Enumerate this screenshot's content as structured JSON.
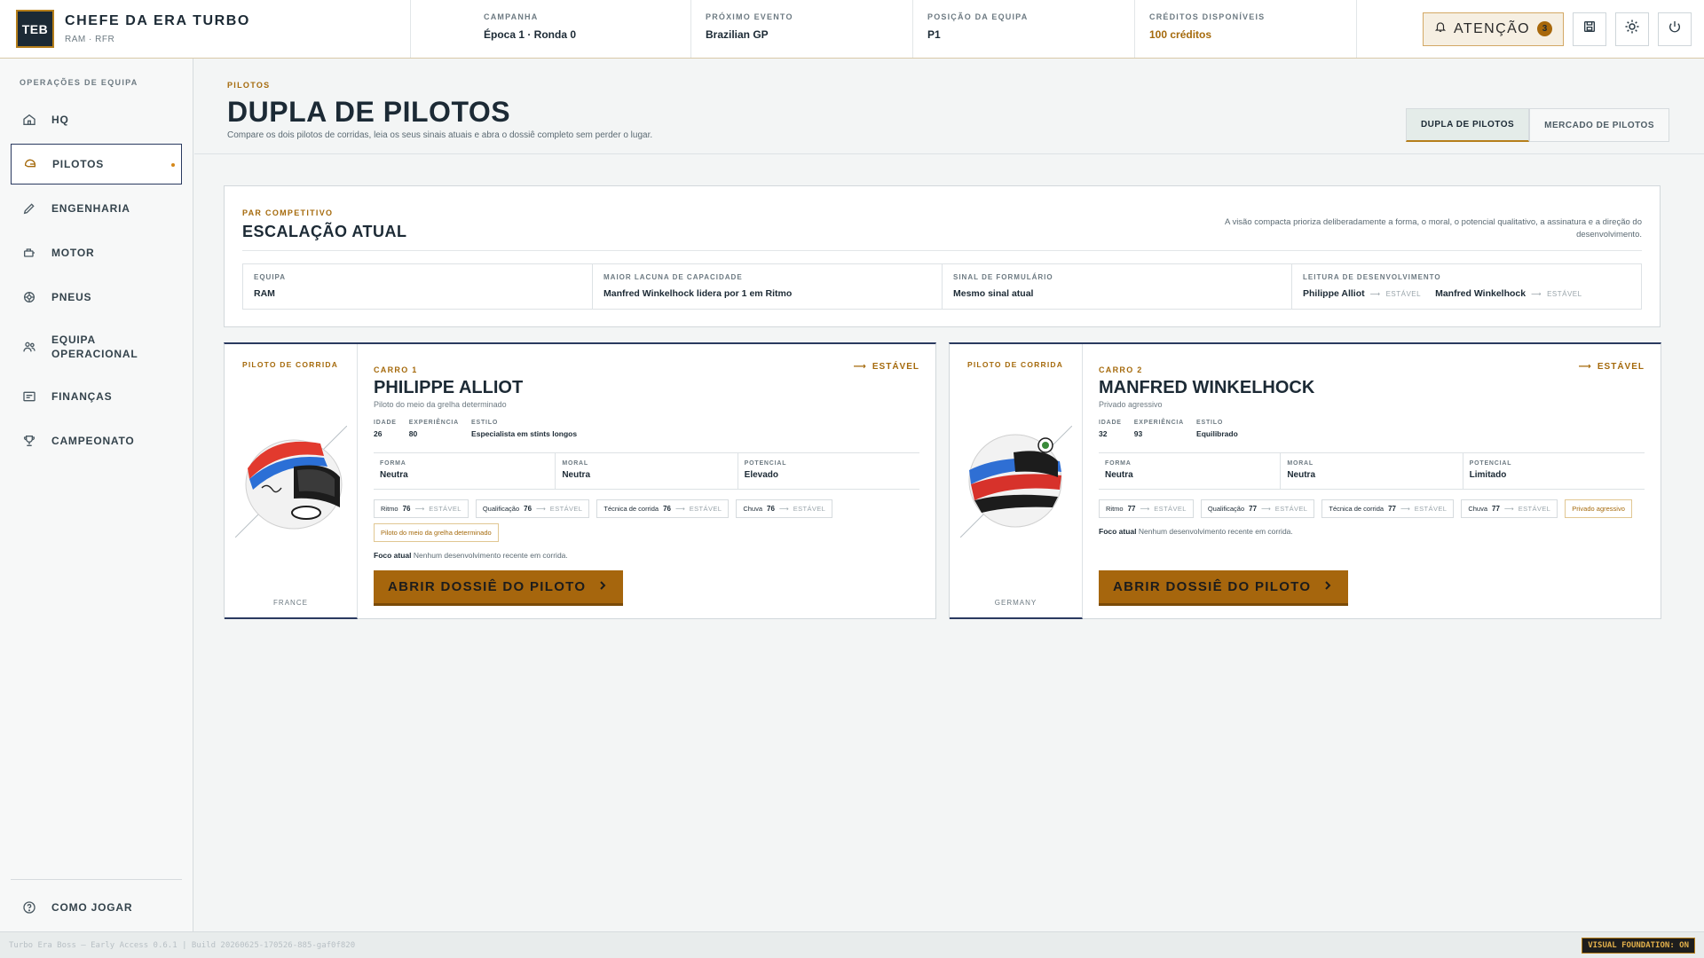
{
  "app": {
    "logo_text": "TEB",
    "title": "CHEFE DA ERA TURBO",
    "subtitle": "RAM · RFR"
  },
  "metrics": [
    {
      "label": "CAMPANHA",
      "value": "Época 1 · Ronda 0"
    },
    {
      "label": "PRÓXIMO EVENTO",
      "value": "Brazilian GP"
    },
    {
      "label": "POSIÇÃO DA EQUIPA",
      "value": "P1"
    },
    {
      "label": "CRÉDITOS DISPONÍVEIS",
      "value": "100 créditos"
    }
  ],
  "top_actions": {
    "attention_label": "ATENÇÃO",
    "attention_count": "3"
  },
  "sidebar": {
    "heading": "OPERAÇÕES DE EQUIPA",
    "items": [
      {
        "label": "HQ",
        "icon": "home-icon"
      },
      {
        "label": "PILOTOS",
        "icon": "helmet-icon",
        "active": true
      },
      {
        "label": "ENGENHARIA",
        "icon": "pencil-icon"
      },
      {
        "label": "MOTOR",
        "icon": "engine-icon"
      },
      {
        "label": "PNEUS",
        "icon": "tyre-icon"
      },
      {
        "label": "EQUIPA OPERACIONAL",
        "icon": "people-icon"
      },
      {
        "label": "FINANÇAS",
        "icon": "ledger-icon"
      },
      {
        "label": "CAMPEONATO",
        "icon": "trophy-icon"
      }
    ],
    "footer_item": {
      "label": "COMO JOGAR",
      "icon": "help-icon"
    }
  },
  "page": {
    "eyebrow": "PILOTOS",
    "title": "DUPLA DE PILOTOS",
    "description": "Compare os dois pilotos de corridas, leia os seus sinais atuais e abra o dossiê completo sem perder o lugar.",
    "tabs": [
      {
        "label": "DUPLA DE PILOTOS",
        "active": true
      },
      {
        "label": "MERCADO DE PILOTOS",
        "active": false
      }
    ]
  },
  "lineup": {
    "eyebrow": "PAR COMPETITIVO",
    "title": "ESCALAÇÃO ATUAL",
    "note": "A visão compacta prioriza deliberadamente a forma, o moral, o potencial qualitativo, a assinatura e a direção do desenvolvimento.",
    "cells": [
      {
        "label": "EQUIPA",
        "value": "RAM"
      },
      {
        "label": "MAIOR LACUNA DE CAPACIDADE",
        "value": "Manfred Winkelhock lidera por 1 em Ritmo"
      },
      {
        "label": "SINAL DE FORMULÁRIO",
        "value": "Mesmo sinal atual"
      },
      {
        "label": "LEITURA DE DESENVOLVIMENTO",
        "driver1": "Philippe Alliot",
        "driver1_trend": "ESTÁVEL",
        "driver2": "Manfred Winkelhock",
        "driver2_trend": "ESTÁVEL"
      }
    ]
  },
  "drivers": [
    {
      "role": "PILOTO DE CORRIDA",
      "country": "FRANCE",
      "car": "CARRO 1",
      "trend": "ESTÁVEL",
      "name": "PHILIPPE ALLIOT",
      "archetype": "Piloto do meio da grelha determinado",
      "facts": [
        {
          "label": "IDADE",
          "value": "26"
        },
        {
          "label": "EXPERIÊNCIA",
          "value": "80"
        },
        {
          "label": "ESTILO",
          "value": "Especialista em stints longos"
        }
      ],
      "signals": [
        {
          "label": "FORMA",
          "value": "Neutra"
        },
        {
          "label": "MORAL",
          "value": "Neutra"
        },
        {
          "label": "POTENCIAL",
          "value": "Elevado"
        }
      ],
      "stats": [
        {
          "label": "Ritmo",
          "value": "76",
          "trend": "ESTÁVEL"
        },
        {
          "label": "Qualificação",
          "value": "76",
          "trend": "ESTÁVEL"
        },
        {
          "label": "Técnica de corrida",
          "value": "76",
          "trend": "ESTÁVEL"
        },
        {
          "label": "Chuva",
          "value": "76",
          "trend": "ESTÁVEL"
        }
      ],
      "trait": "Piloto do meio da grelha determinado",
      "focus_label": "Foco atual",
      "focus_value": "Nenhum desenvolvimento recente em corrida.",
      "button": "ABRIR DOSSIÊ DO PILOTO",
      "helmet_colors": [
        "#e23a2e",
        "#2b6fd6",
        "#f4f4f4"
      ]
    },
    {
      "role": "PILOTO DE CORRIDA",
      "country": "GERMANY",
      "car": "CARRO 2",
      "trend": "ESTÁVEL",
      "name": "MANFRED WINKELHOCK",
      "archetype": "Privado agressivo",
      "facts": [
        {
          "label": "IDADE",
          "value": "32"
        },
        {
          "label": "EXPERIÊNCIA",
          "value": "93"
        },
        {
          "label": "ESTILO",
          "value": "Equilibrado"
        }
      ],
      "signals": [
        {
          "label": "FORMA",
          "value": "Neutra"
        },
        {
          "label": "MORAL",
          "value": "Neutra"
        },
        {
          "label": "POTENCIAL",
          "value": "Limitado"
        }
      ],
      "stats": [
        {
          "label": "Ritmo",
          "value": "77",
          "trend": "ESTÁVEL"
        },
        {
          "label": "Qualificação",
          "value": "77",
          "trend": "ESTÁVEL"
        },
        {
          "label": "Técnica de corrida",
          "value": "77",
          "trend": "ESTÁVEL"
        },
        {
          "label": "Chuva",
          "value": "77",
          "trend": "ESTÁVEL"
        }
      ],
      "trait": "Privado agressivo",
      "focus_label": "Foco atual",
      "focus_value": "Nenhum desenvolvimento recente em corrida.",
      "button": "ABRIR DOSSIÊ DO PILOTO",
      "helmet_colors": [
        "#2f6fd4",
        "#d7322b",
        "#f4f4f4"
      ]
    }
  ],
  "status": {
    "build": "Turbo Era Boss — Early Access 0.6.1 | Build 20260625-170526-885-gaf0f820",
    "visual_foundation": "VISUAL FOUNDATION: ON"
  }
}
